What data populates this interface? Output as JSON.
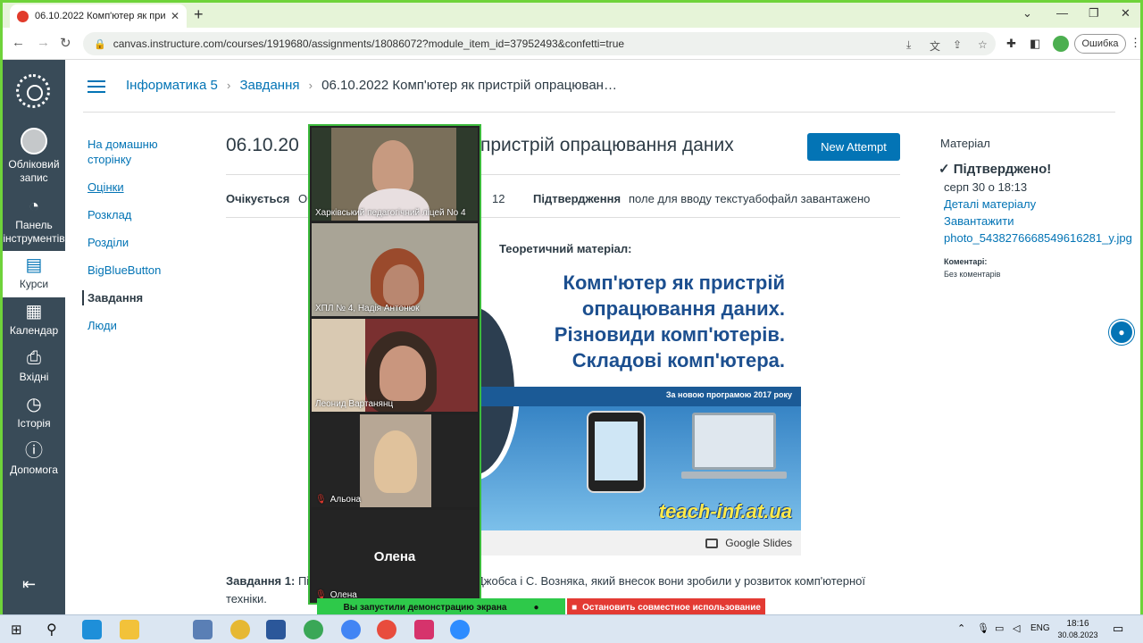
{
  "browser": {
    "tab_title": "06.10.2022 Комп'ютер як пристр",
    "url": "canvas.instructure.com/courses/1919680/assignments/18086072?module_item_id=37952493&confetti=true",
    "error_label": "Ошибка"
  },
  "global_nav": {
    "account": "Обліковий запис",
    "dashboard": "Панель інструментів",
    "courses": "Курси",
    "calendar": "Календар",
    "inbox": "Вхідні",
    "history": "Історія",
    "help": "Допомога"
  },
  "breadcrumb": {
    "course": "Інформатика 5",
    "section": "Завдання",
    "current": "06.10.2022 Комп'ютер як пристрій опрацюван…"
  },
  "course_nav": {
    "items": [
      "На домашню сторінку",
      "Оцінки",
      "Розклад",
      "Розділи",
      "BigBlueButton",
      "Завдання",
      "Люди"
    ]
  },
  "assignment": {
    "title_start": "06.10.20",
    "title_end": "пристрій опрацювання даних",
    "new_attempt": "New Attempt",
    "due_label": "Очікується",
    "due_value": "Оч",
    "points_value": "12",
    "submission_label": "Підтвердження",
    "submission_value": "поле для вводу текстуабофайл завантажено",
    "theory_heading": "Теоретичний матеріал:",
    "task_label": "Завдання 1:",
    "task_text_start": "Пі",
    "task_text_end": "Джобса і С. Возняка, який внесок вони зробили у розвиток комп'ютерної",
    "task_text_line2": "техніки."
  },
  "slide": {
    "title": "Комп'ютер як пристрій опрацювання даних. Різновиди комп'ютерів. Складові комп'ютера.",
    "program": "За новою програмою 2017 року",
    "site": "teach-inf.at.ua",
    "google_slides": "Google Slides"
  },
  "sidebar": {
    "heading": "Матеріал",
    "confirmed": "Підтверджено!",
    "date": "серп 30 о 18:13",
    "details_link": "Деталі матеріалу",
    "download_link": "Завантажити",
    "file_link": "photo_5438276668549616281_y.jpg",
    "comments_label": "Коментарі:",
    "comments_value": "Без коментарів"
  },
  "zoom": {
    "participants": [
      "Харківський педагогічний ліцей No 4",
      "ХПЛ № 4, Надія Антонюк",
      "Леонид Вартанянц",
      "Альона",
      "Олена"
    ],
    "big_name": "Олена",
    "share_status": "Вы запустили демонстрацию экрана",
    "stop_share": "Остановить совместное использование"
  },
  "taskbar": {
    "lang": "ENG",
    "time": "18:16",
    "date": "30.08.2023"
  },
  "colors": {
    "canvas_blue": "#0374b5",
    "nav_dark": "#394b58",
    "zoom_green": "#2ec94a",
    "zoom_red": "#e33a33"
  }
}
